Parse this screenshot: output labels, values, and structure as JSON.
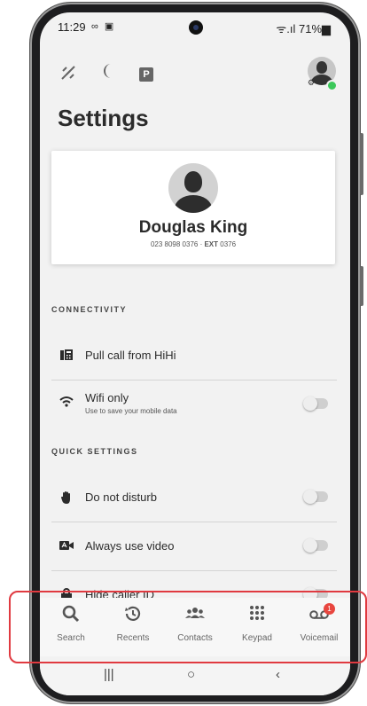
{
  "status_bar": {
    "time": "11:29",
    "left_icons": "∞ ▣",
    "right_text": "ᯤ.ıl 71%▆"
  },
  "toolbar": {
    "icons": [
      "satellite-icon",
      "moon-icon",
      "parking-icon"
    ],
    "parking_glyph": "P"
  },
  "page": {
    "title": "Settings"
  },
  "profile": {
    "name": "Douglas King",
    "number": "023  8098 0376 · ",
    "ext_label": "EXT",
    "ext": " 0376"
  },
  "sections": {
    "connectivity": "CONNECTIVITY",
    "quick_settings": "QUICK SETTINGS"
  },
  "rows": {
    "pull_call": {
      "label": "Pull call from HiHi"
    },
    "wifi_only": {
      "label": "Wifi only",
      "sub": "Use to save your mobile data",
      "enabled": false
    },
    "dnd": {
      "label": "Do not disturb",
      "enabled": false
    },
    "video": {
      "label": "Always use video",
      "enabled": false
    },
    "hide_caller": {
      "label": "Hide caller ID",
      "enabled": false
    }
  },
  "bottom_nav": {
    "items": [
      {
        "label": "Search",
        "icon": "search-icon"
      },
      {
        "label": "Recents",
        "icon": "history-icon"
      },
      {
        "label": "Contacts",
        "icon": "contacts-icon"
      },
      {
        "label": "Keypad",
        "icon": "keypad-icon"
      },
      {
        "label": "Voicemail",
        "icon": "voicemail-icon",
        "badge": "1"
      }
    ]
  },
  "system_nav": {
    "recent": "|||",
    "home": "○",
    "back": "‹"
  },
  "colors": {
    "accent": "#3cc85a",
    "badge": "#e8463f",
    "highlight": "#e03a40"
  }
}
